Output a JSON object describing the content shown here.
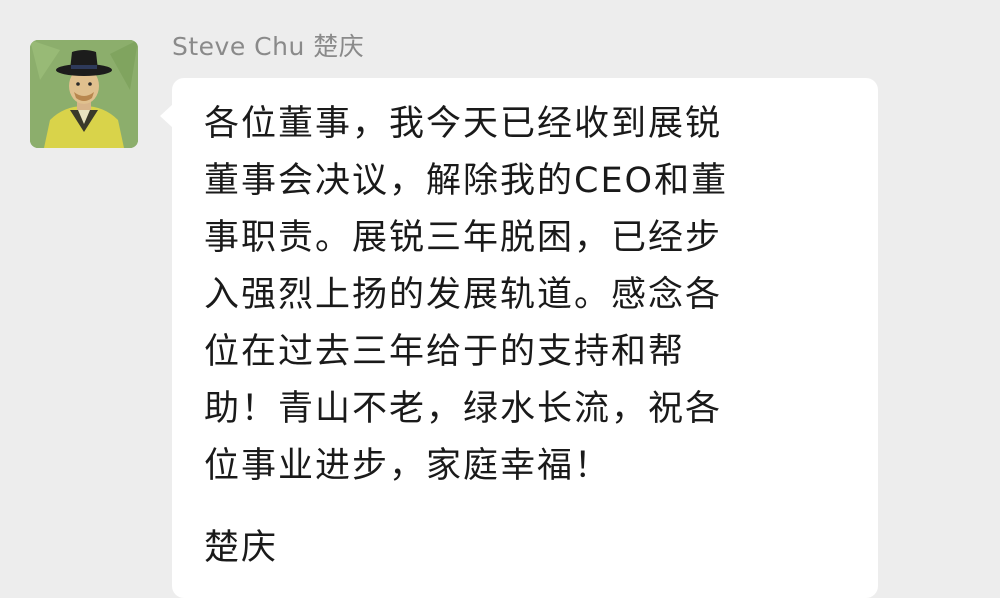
{
  "message": {
    "sender_name": "Steve Chu 楚庆",
    "avatar": "van-gogh-portrait-avatar",
    "lines": [
      "各位董事，我今天已经收到展锐",
      "董事会决议，解除我的CEO和董",
      "事职责。展锐三年脱困，已经步",
      "入强烈上扬的发展轨道。感念各",
      "位在过去三年给于的支持和帮",
      "助！青山不老，绿水长流，祝各",
      "位事业进步，家庭幸福！"
    ],
    "signature": "楚庆"
  },
  "colors": {
    "background": "#ededed",
    "bubble": "#ffffff",
    "sender_name": "#8a8a8a",
    "text": "#1a1a1a"
  }
}
